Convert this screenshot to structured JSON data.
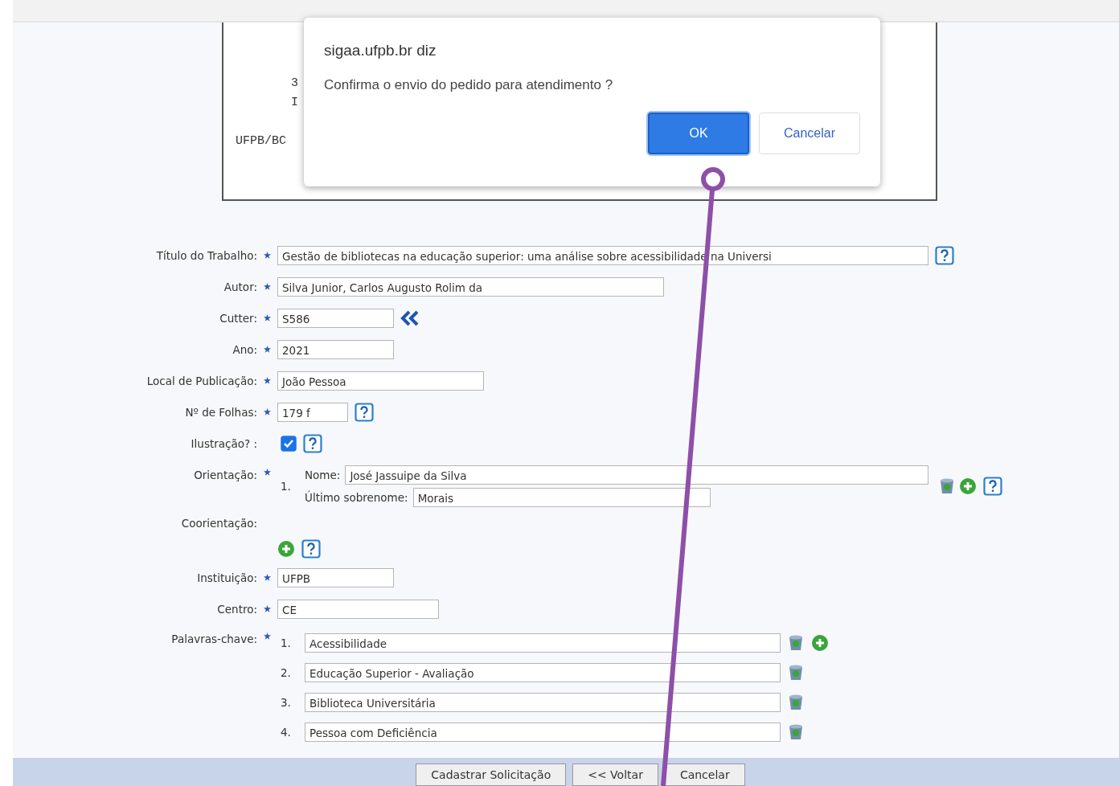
{
  "card": {
    "lines": [
      "3",
      "I"
    ],
    "location": "UFPB/BC"
  },
  "dialog": {
    "origin": "sigaa.ufpb.br diz",
    "message": "Confirma o envio do pedido para atendimento ?",
    "buttons": [
      {
        "label": "OK",
        "selected": true
      },
      {
        "label": "Cancelar",
        "selected": false
      }
    ]
  },
  "fields": [
    {
      "kind": "text",
      "label": "Título do Trabalho:",
      "required": true,
      "help": true,
      "value": "Gestão de bibliotecas na educação superior: uma análise sobre acessibilidade na Universi"
    },
    {
      "kind": "text",
      "label": "Autor:",
      "required": true,
      "help": false,
      "value": "Silva Junior, Carlos Augusto Rolim da"
    },
    {
      "kind": "text",
      "label": "Cutter:",
      "required": true,
      "help": false,
      "back": true,
      "value": "S586"
    },
    {
      "kind": "text",
      "label": "Ano:",
      "required": true,
      "help": false,
      "value": "2021"
    },
    {
      "kind": "text",
      "label": "Local de Publicação:",
      "required": true,
      "help": false,
      "value": "João Pessoa"
    },
    {
      "kind": "text",
      "label": "Nº de Folhas:",
      "required": true,
      "help": true,
      "value": "179 f"
    },
    {
      "kind": "checkbox",
      "label": "Ilustração? :",
      "required": false,
      "help": true,
      "checked": true
    },
    {
      "kind": "people",
      "label": "Orientação:",
      "required": true,
      "help": true,
      "entries": [
        {
          "number": "1.",
          "name_label": "Nome:",
          "name": "José Jassuipe da Silva",
          "surname_label": "Último sobrenome:",
          "surname": "Morais"
        }
      ]
    },
    {
      "kind": "add",
      "label": "Coorientação:",
      "required": false,
      "help": true
    },
    {
      "kind": "text",
      "label": "Instituição:",
      "required": true,
      "help": false,
      "value": "UFPB"
    },
    {
      "kind": "text",
      "label": "Centro:",
      "required": true,
      "help": false,
      "value": "CE"
    },
    {
      "kind": "list",
      "label": "Palavras-chave:",
      "required": true,
      "help": false,
      "items": [
        {
          "number": "1.",
          "value": "Acessibilidade"
        },
        {
          "number": "2.",
          "value": "Educação Superior - Avaliação"
        },
        {
          "number": "3.",
          "value": "Biblioteca Universitária"
        },
        {
          "number": "4.",
          "value": "Pessoa com Deficiência"
        }
      ]
    }
  ],
  "footer_buttons": [
    "Cadastrar Solicitação",
    "<< Voltar",
    "Cancelar"
  ]
}
